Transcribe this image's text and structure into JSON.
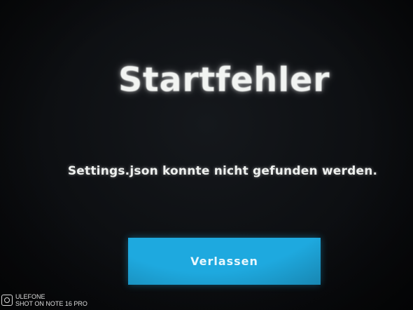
{
  "dialog": {
    "title": "Startfehler",
    "message": "Settings.json konnte nicht gefunden werden.",
    "exit_button_label": "Verlassen"
  },
  "colors": {
    "background": "#0d0f12",
    "text": "#f2f4f2",
    "button": "#1ea9df"
  },
  "watermark": {
    "brand": "ULEFONE",
    "caption": "SHOT ON NOTE 16 PRO",
    "icon": "camera-icon"
  }
}
